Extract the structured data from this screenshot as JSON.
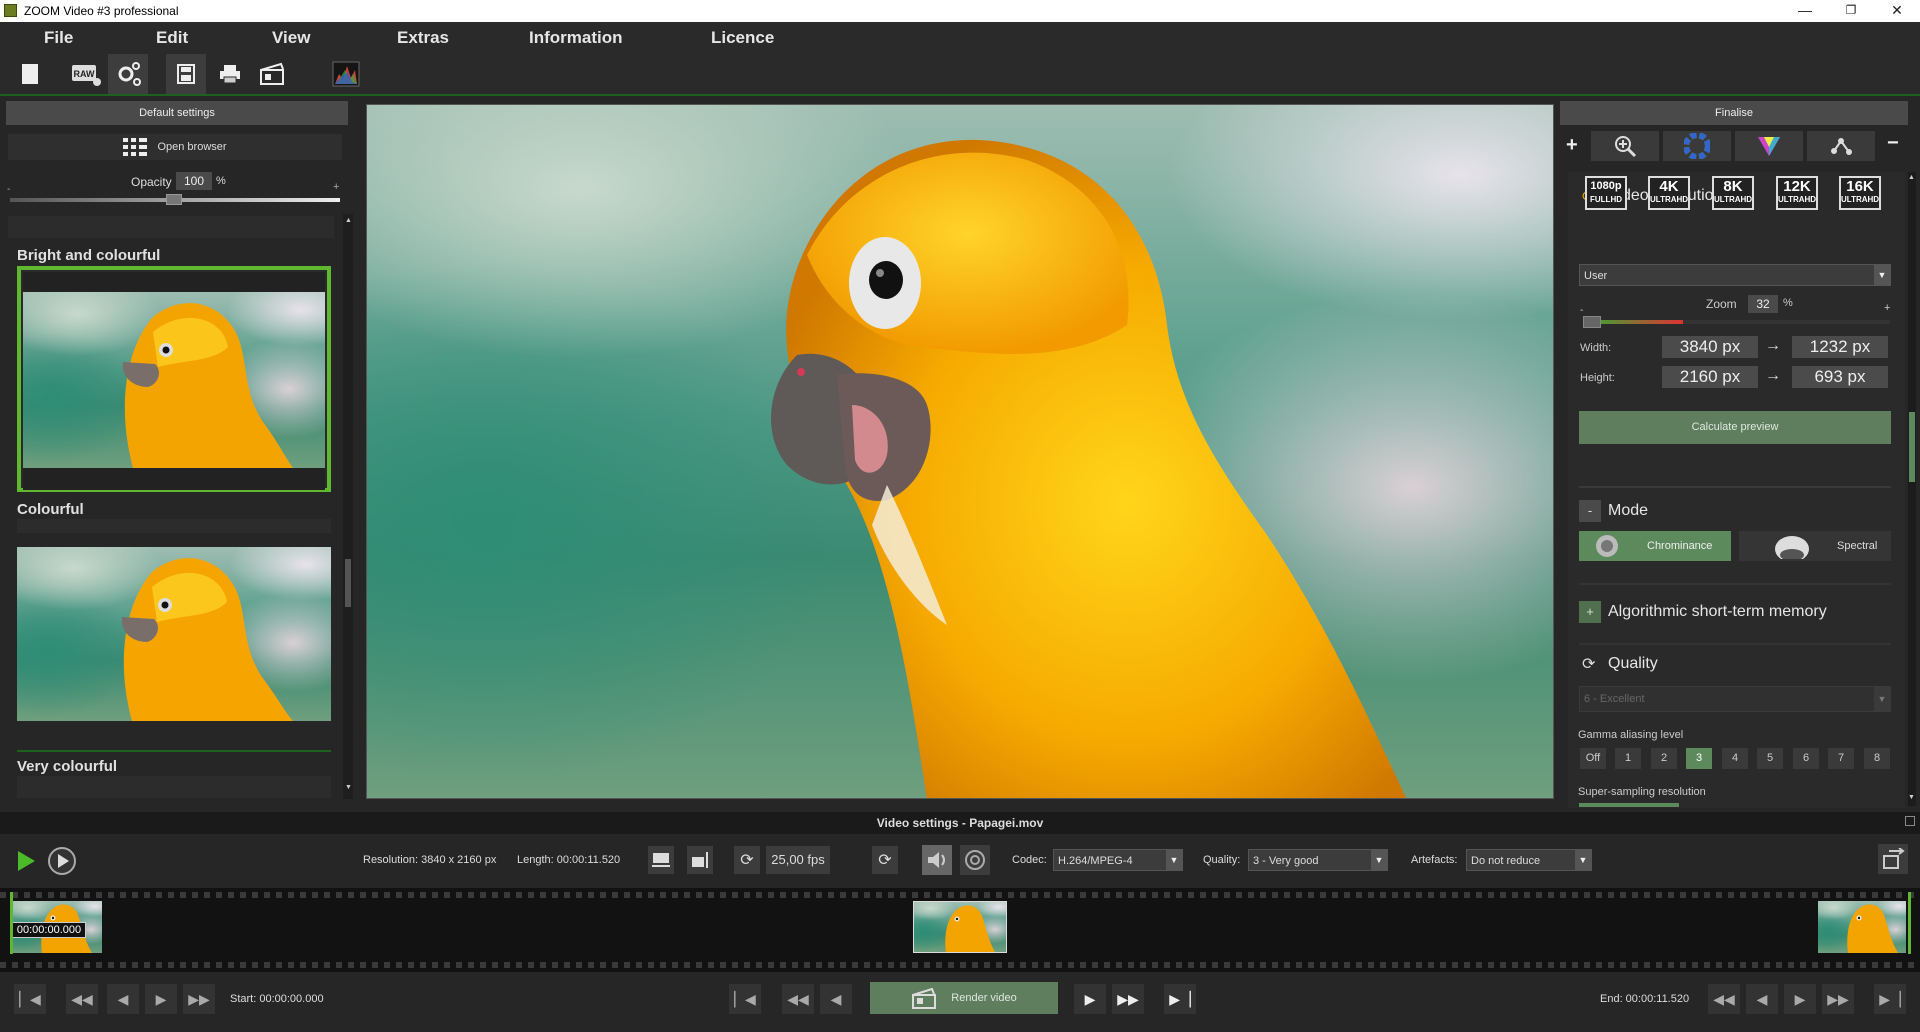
{
  "window": {
    "title": "ZOOM Video #3 professional",
    "minimize": "—",
    "maximize": "❐",
    "close": "✕"
  },
  "menu": [
    "File",
    "Edit",
    "View",
    "Extras",
    "Information",
    "Licence"
  ],
  "toolbar": {
    "icons": [
      "new-document-icon",
      "raw-settings-icon",
      "effects-settings-icon",
      "save-icon",
      "print-icon",
      "video-export-icon",
      "histogram-icon"
    ],
    "raw_label": "RAW"
  },
  "left_panel": {
    "header": "Default settings",
    "open_browser": "Open browser",
    "opacity_label": "Opacity",
    "opacity_value": "100",
    "opacity_unit": "%",
    "minus": "-",
    "plus": "+",
    "presets": [
      {
        "label": "Bright and colourful",
        "selected": true
      },
      {
        "label": "Colourful",
        "selected": false
      },
      {
        "label": "Very colourful",
        "selected": false
      }
    ]
  },
  "right_panel": {
    "header": "Finalise",
    "add": "+",
    "remove": "−",
    "tab_icons": [
      "zoom-icon",
      "color-wheel-icon",
      "color-prism-icon",
      "share-nodes-icon"
    ],
    "video_resolution": {
      "title": "Video resolution",
      "presets": [
        {
          "big": "1080p",
          "small": "FULLHD"
        },
        {
          "big": "4K",
          "small": "ULTRAHD"
        },
        {
          "big": "8K",
          "small": "ULTRAHD"
        },
        {
          "big": "12K",
          "small": "ULTRAHD"
        },
        {
          "big": "16K",
          "small": "ULTRAHD"
        }
      ],
      "preset_select": "User",
      "zoom_label": "Zoom",
      "zoom_value": "32",
      "zoom_unit": "%",
      "zoom_level": 0.32,
      "minus": "-",
      "plus": "+",
      "width_label": "Width:",
      "height_label": "Height:",
      "width_from": "3840 px",
      "width_to": "1232 px",
      "height_from": "2160 px",
      "height_to": "693 px",
      "arrow": "→",
      "calc_button": "Calculate preview"
    },
    "mode": {
      "title": "Mode",
      "toggle": "-",
      "options": [
        {
          "label": "Chrominance",
          "selected": true
        },
        {
          "label": "Spectral",
          "selected": false
        }
      ]
    },
    "memory": {
      "title": "Algorithmic short-term memory",
      "toggle": "+"
    },
    "quality": {
      "title": "Quality",
      "select": "6 - Excellent",
      "gamma_label": "Gamma aliasing level",
      "gamma_levels": [
        "Off",
        "1",
        "2",
        "3",
        "4",
        "5",
        "6",
        "7",
        "8"
      ],
      "gamma_selected": "3",
      "supersampling_label": "Super-sampling resolution"
    }
  },
  "video_bar": {
    "title": "Video settings - Papagei.mov",
    "resolution": "Resolution: 3840 x 2160 px",
    "length": "Length: 00:00:11.520",
    "fps": "25,00 fps",
    "codec_label": "Codec:",
    "codec_value": "H.264/MPEG-4",
    "quality_label": "Quality:",
    "quality_value": "3 - Very good",
    "artefacts_label": "Artefacts:",
    "artefacts_value": "Do not reduce"
  },
  "timeline": {
    "start_time": "00:00:00.000",
    "start_label": "Start: 00:00:00.000",
    "end_label": "End: 00:00:11.520",
    "render_button": "Render video"
  },
  "colors": {
    "accent_green": "#5fb830",
    "panel": "#2a2a2a",
    "selected_green": "#5d8a5d",
    "parrot_orange": "#f2a500"
  }
}
